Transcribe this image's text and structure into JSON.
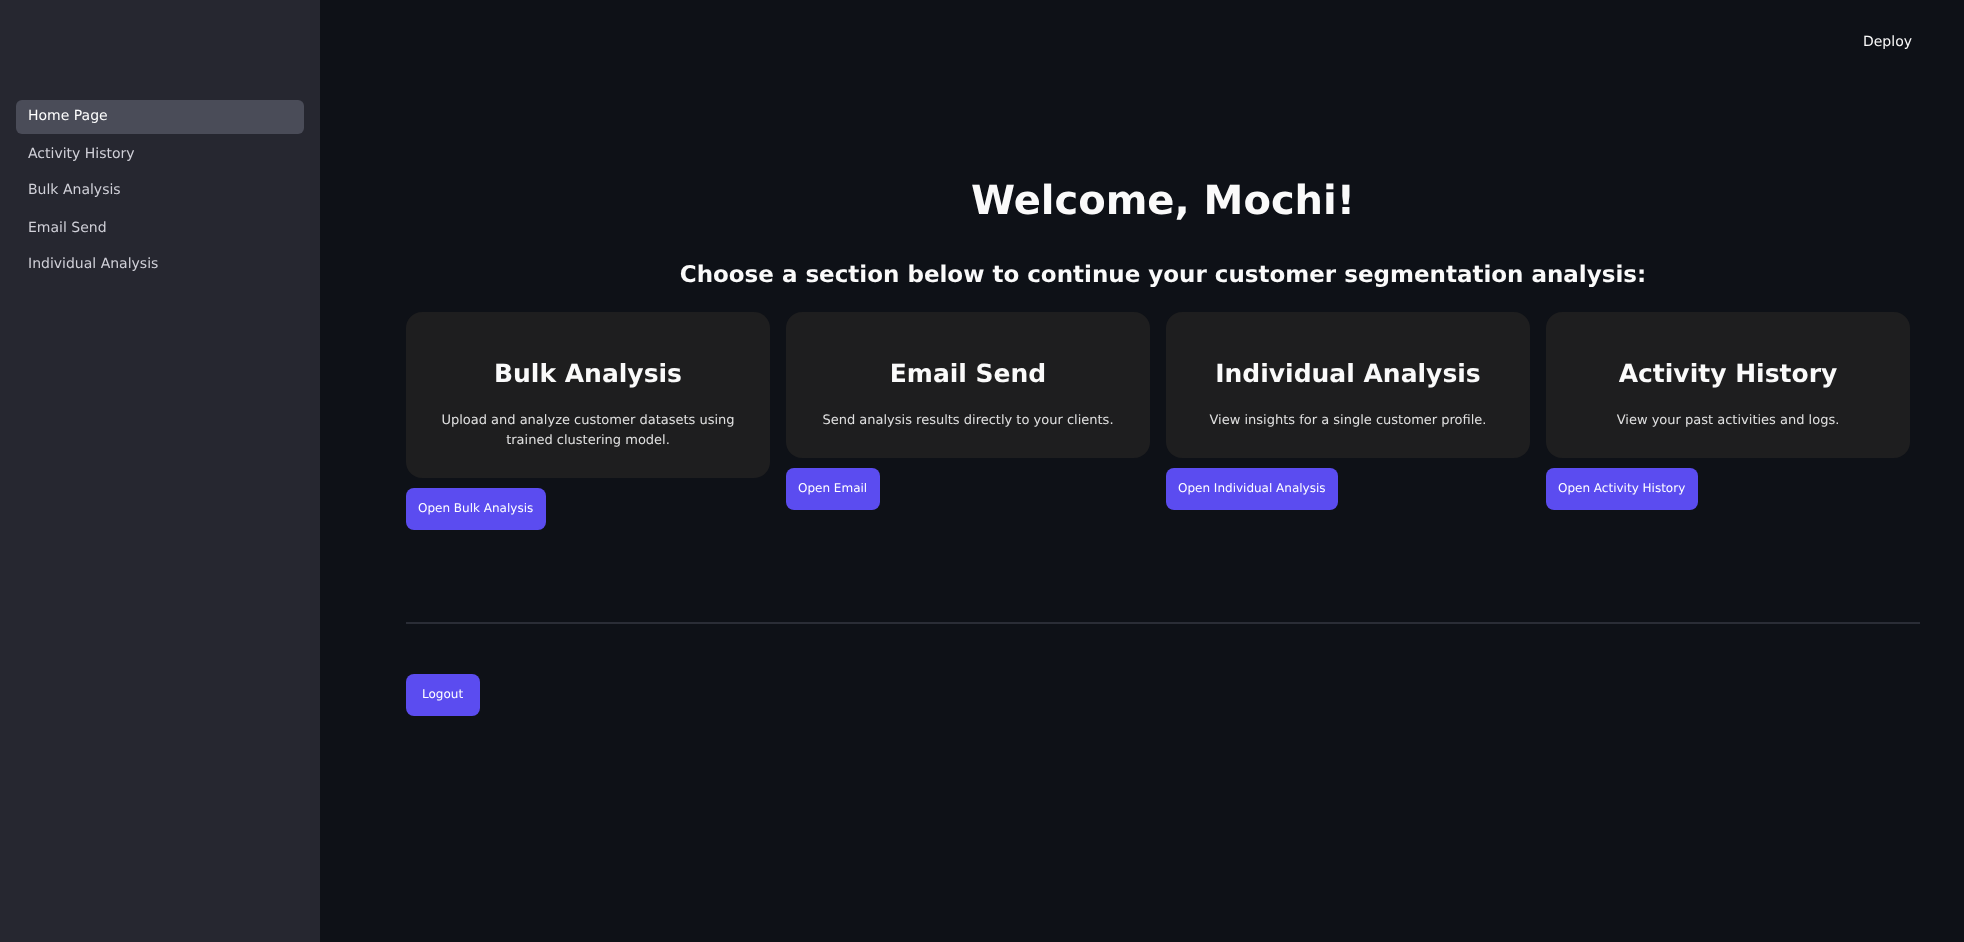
{
  "sidebar": {
    "items": [
      {
        "label": "Home Page",
        "selected": true
      },
      {
        "label": "Activity History",
        "selected": false
      },
      {
        "label": "Bulk Analysis",
        "selected": false
      },
      {
        "label": "Email Send",
        "selected": false
      },
      {
        "label": "Individual Analysis",
        "selected": false
      }
    ]
  },
  "header": {
    "deploy": "Deploy"
  },
  "title": "Welcome, Mochi!",
  "subtitle": "Choose a section below to continue your customer segmentation analysis:",
  "cards": [
    {
      "title": "Bulk Analysis",
      "description": "Upload and analyze customer datasets using trained clustering model.",
      "button": "Open Bulk Analysis"
    },
    {
      "title": "Email Send",
      "description": "Send analysis results directly to your clients.",
      "button": "Open Email"
    },
    {
      "title": "Individual Analysis",
      "description": "View insights for a single customer profile.",
      "button": "Open Individual Analysis"
    },
    {
      "title": "Activity History",
      "description": "View your past activities and logs.",
      "button": "Open Activity History"
    }
  ],
  "logout": "Logout"
}
